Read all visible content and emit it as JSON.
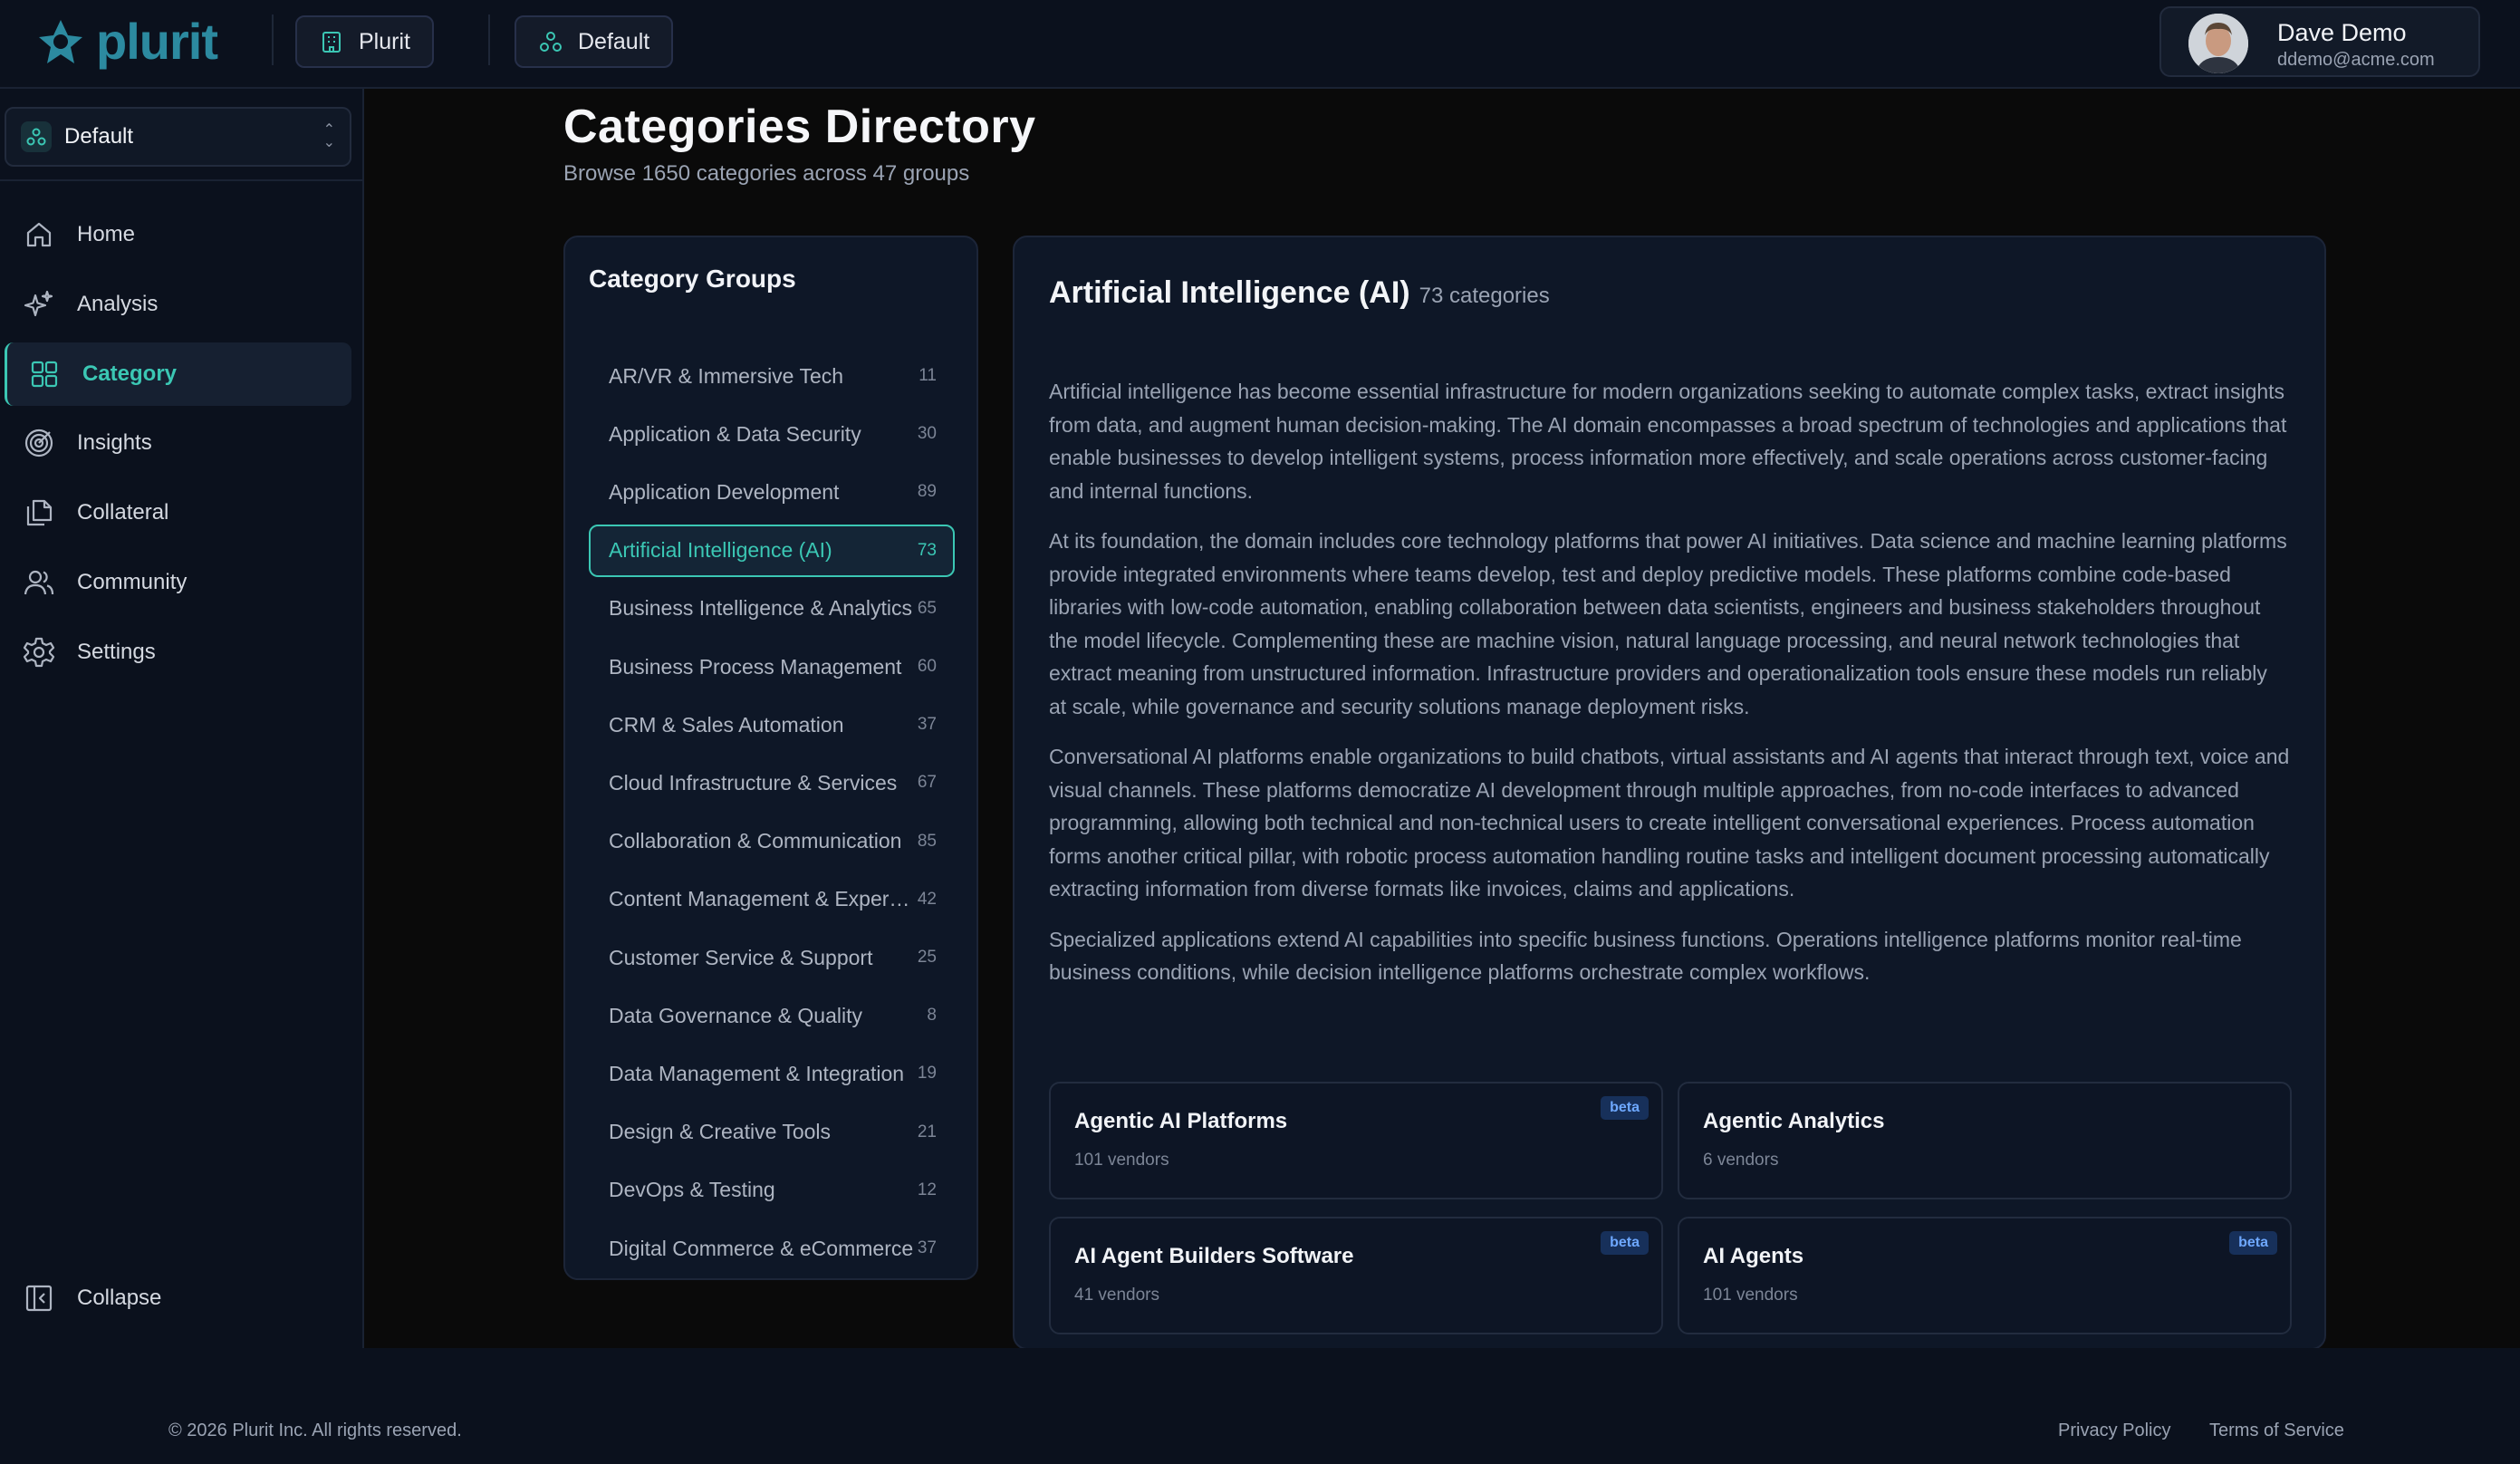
{
  "brand": {
    "name": "plurit"
  },
  "topbar": {
    "workspace_chip": "Plurit",
    "org_chip": "Default"
  },
  "user": {
    "name": "Dave Demo",
    "email": "ddemo@acme.com"
  },
  "sidebar": {
    "org_select": "Default",
    "items": [
      {
        "label": "Home",
        "icon": "home-icon"
      },
      {
        "label": "Analysis",
        "icon": "sparkles-icon"
      },
      {
        "label": "Category",
        "icon": "grid-icon",
        "active": true
      },
      {
        "label": "Insights",
        "icon": "target-icon"
      },
      {
        "label": "Collateral",
        "icon": "files-icon"
      },
      {
        "label": "Community",
        "icon": "users-icon"
      },
      {
        "label": "Settings",
        "icon": "gear-icon"
      }
    ],
    "collapse": "Collapse"
  },
  "page": {
    "title": "Categories Directory",
    "subtitle": "Browse 1650 categories across 47 groups"
  },
  "groups": {
    "title": "Category Groups",
    "items": [
      {
        "label": "AR/VR & Immersive Tech",
        "count": "11"
      },
      {
        "label": "Application & Data Security",
        "count": "30"
      },
      {
        "label": "Application Development",
        "count": "89"
      },
      {
        "label": "Artificial Intelligence (AI)",
        "count": "73",
        "active": true
      },
      {
        "label": "Business Intelligence & Analytics",
        "count": "65"
      },
      {
        "label": "Business Process Management",
        "count": "60"
      },
      {
        "label": "CRM & Sales Automation",
        "count": "37"
      },
      {
        "label": "Cloud Infrastructure & Services",
        "count": "67"
      },
      {
        "label": "Collaboration & Communication",
        "count": "85"
      },
      {
        "label": "Content Management & Experience",
        "count": "42"
      },
      {
        "label": "Customer Service & Support",
        "count": "25"
      },
      {
        "label": "Data Governance & Quality",
        "count": "8"
      },
      {
        "label": "Data Management & Integration",
        "count": "19"
      },
      {
        "label": "Design & Creative Tools",
        "count": "21"
      },
      {
        "label": "DevOps & Testing",
        "count": "12"
      },
      {
        "label": "Digital Commerce & eCommerce",
        "count": "37"
      }
    ]
  },
  "detail": {
    "title": "Artificial Intelligence (AI)",
    "count": "73 categories",
    "paragraphs": [
      "Artificial intelligence has become essential infrastructure for modern organizations seeking to automate complex tasks, extract insights from data, and augment human decision-making. The AI domain encompasses a broad spectrum of technologies and applications that enable businesses to develop intelligent systems, process information more effectively, and scale operations across customer-facing and internal functions.",
      "At its foundation, the domain includes core technology platforms that power AI initiatives. Data science and machine learning platforms provide integrated environments where teams develop, test and deploy predictive models. These platforms combine code-based libraries with low-code automation, enabling collaboration between data scientists, engineers and business stakeholders throughout the model lifecycle. Complementing these are machine vision, natural language processing, and neural network technologies that extract meaning from unstructured information. Infrastructure providers and operationalization tools ensure these models run reliably at scale, while governance and security solutions manage deployment risks.",
      "Conversational AI platforms enable organizations to build chatbots, virtual assistants and AI agents that interact through text, voice and visual channels. These platforms democratize AI development through multiple approaches, from no-code interfaces to advanced programming, allowing both technical and non-technical users to create intelligent conversational experiences. Process automation forms another critical pillar, with robotic process automation handling routine tasks and intelligent document processing automatically extracting information from diverse formats like invoices, claims and applications.",
      "Specialized applications extend AI capabilities into specific business functions. Operations intelligence platforms monitor real-time business conditions, while decision intelligence platforms orchestrate complex workflows."
    ],
    "cards": [
      {
        "name": "Agentic AI Platforms",
        "vendors": "101 vendors",
        "badge": "beta"
      },
      {
        "name": "Agentic Analytics",
        "vendors": "6 vendors",
        "badge": ""
      },
      {
        "name": "AI Agent Builders Software",
        "vendors": "41 vendors",
        "badge": "beta"
      },
      {
        "name": "AI Agents",
        "vendors": "101 vendors",
        "badge": "beta"
      }
    ]
  },
  "footer": {
    "copyright": "© 2026 Plurit Inc. All rights reserved.",
    "privacy": "Privacy Policy",
    "terms": "Terms of Service"
  },
  "colors": {
    "accent": "#3bc7b4",
    "brand": "#2c8aa0",
    "background": "#0a0a0a",
    "panel": "#0e1727",
    "beta": "#6ea8ff"
  }
}
